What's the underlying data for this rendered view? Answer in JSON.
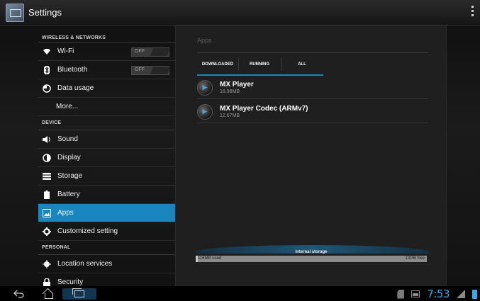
{
  "app": {
    "title": "Settings"
  },
  "left": {
    "wireless_header": "WIRELESS & NETWORKS",
    "wifi": {
      "label": "Wi-Fi",
      "toggle": "OFF"
    },
    "bluetooth": {
      "label": "Bluetooth",
      "toggle": "OFF"
    },
    "data_usage": "Data usage",
    "more": "More...",
    "device_header": "DEVICE",
    "sound": "Sound",
    "display": "Display",
    "storage": "Storage",
    "battery": "Battery",
    "apps": "Apps",
    "customized": "Customized setting",
    "personal_header": "PERSONAL",
    "location": "Location services",
    "security": "Security"
  },
  "panel": {
    "title": "Apps",
    "tabs": [
      "DOWNLOADED",
      "RUNNING",
      "ALL"
    ],
    "selected_tab": "DOWNLOADED",
    "apps": [
      {
        "name": "MX Player",
        "size": "16.98MB"
      },
      {
        "name": "MX Player Codec (ARMv7)",
        "size": "12.67MB"
      }
    ],
    "storage": {
      "title": "Internal storage",
      "used": "116MB used",
      "free": "13GB free",
      "used_fraction": 0.01
    }
  },
  "status": {
    "time": "7:53"
  },
  "colors": {
    "accent": "#1a86c0",
    "clock": "#3ea6e6"
  },
  "icons": {
    "wifi": "wifi-icon",
    "bluetooth": "bluetooth-icon",
    "data_usage": "data-usage-icon",
    "sound": "speaker-icon",
    "display": "display-icon",
    "storage": "storage-icon",
    "battery": "battery-icon",
    "apps": "apps-icon",
    "customized": "gear-icon",
    "location": "location-icon",
    "security": "lock-icon"
  }
}
